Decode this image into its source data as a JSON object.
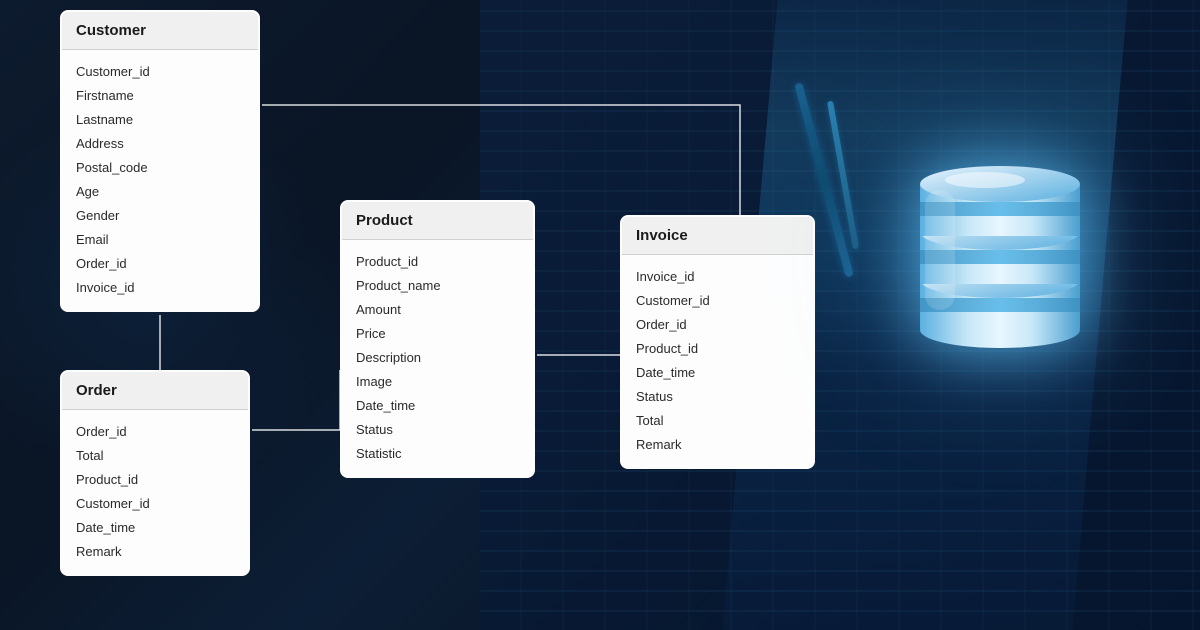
{
  "background": {
    "color": "#0a1628"
  },
  "tables": {
    "customer": {
      "title": "Customer",
      "fields": [
        "Customer_id",
        "Firstname",
        "Lastname",
        "Address",
        "Postal_code",
        "Age",
        "Gender",
        "Email",
        "Order_id",
        "Invoice_id"
      ]
    },
    "order": {
      "title": "Order",
      "fields": [
        "Order_id",
        "Total",
        "Product_id",
        "Customer_id",
        "Date_time",
        "Remark"
      ]
    },
    "product": {
      "title": "Product",
      "fields": [
        "Product_id",
        "Product_name",
        "Amount",
        "Price",
        "Description",
        "Image",
        "Date_time",
        "Status",
        "Statistic"
      ]
    },
    "invoice": {
      "title": "Invoice",
      "fields": [
        "Invoice_id",
        "Customer_id",
        "Order_id",
        "Product_id",
        "Date_time",
        "Status",
        "Total",
        "Remark"
      ]
    }
  },
  "connectors": {
    "lines": [
      {
        "from": "customer-right",
        "to": "invoice-top",
        "label": ""
      },
      {
        "from": "customer-bottom",
        "to": "order-top",
        "label": ""
      },
      {
        "from": "order-right",
        "to": "product-bottom",
        "label": ""
      },
      {
        "from": "product-right",
        "to": "invoice-left",
        "label": ""
      }
    ]
  }
}
